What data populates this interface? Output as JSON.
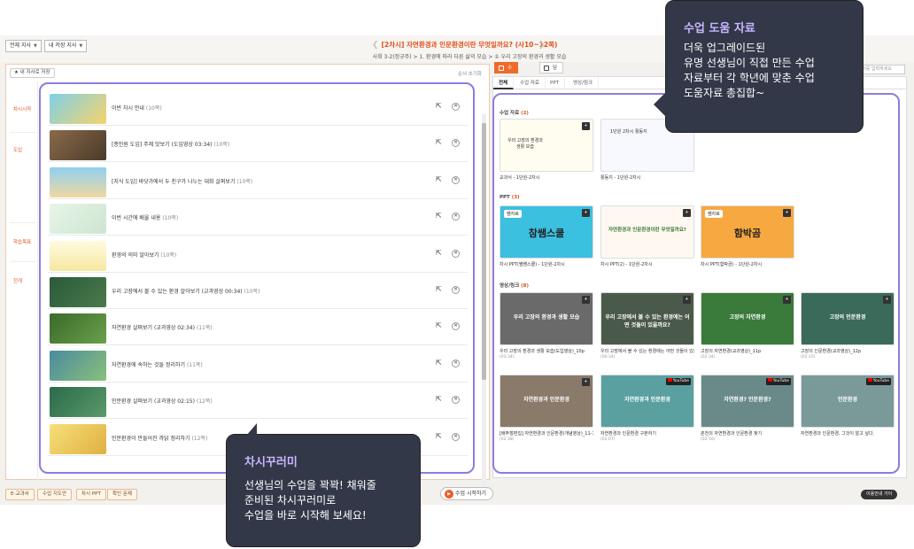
{
  "header": {
    "select_all": "전체 지사",
    "select_mine": "내 저장 지사",
    "title": "[2차시] 자연환경과 인문환경이란 무엇일까요? (사10~12쪽)",
    "subtitle": "사회 3-2(정규주) > 1. 환경에 따라 다른 삶의 모습 > ① 우리 고장의 환경과 생활 모습",
    "prev": "❮",
    "next": "❯"
  },
  "left": {
    "save_button": "★ 내 지사로 저장",
    "reorder": "순서 초기화",
    "phases": [
      "차시시작",
      "도입",
      "학습목표",
      "전개"
    ],
    "rows": [
      {
        "title": "이번 차시 안내",
        "count": "(10쪽)"
      },
      {
        "title": "[종인원 도입] 주제 맛보기 (도입영상 03:34)",
        "count": "(10쪽)"
      },
      {
        "title": "[지식 도입] 바닷가에서 두 친구가 나누는 대화 살펴보기",
        "count": "(10쪽)"
      },
      {
        "title": "이번 시간에 배울 내용",
        "count": "(10쪽)"
      },
      {
        "title": "환경의 의미 알아보기",
        "count": "(10쪽)"
      },
      {
        "title": "우리 고장에서 볼 수 있는 환경 알아보기 (교과영상 00:34)",
        "count": "(10쪽)"
      },
      {
        "title": "자연환경 살펴보기 (교과영상 02:34)",
        "count": "(11쪽)"
      },
      {
        "title": "자연환경에 속하는 것들 정리하기",
        "count": "(11쪽)"
      },
      {
        "title": "인문환경 살펴보기 (교과영상 02:15)",
        "count": "(12쪽)"
      },
      {
        "title": "인문환경이 만들어진 까닭 정리하기",
        "count": "(12쪽)"
      }
    ]
  },
  "bottom": {
    "btn1": "E-교과서",
    "btn2": "수업 지도안",
    "btn3": "차시 PPT",
    "btn4": "확인 문제",
    "start": "수업 시작하기",
    "guide": "이용안내 가이"
  },
  "right": {
    "tab_help": "수업 도움 자료",
    "tab_saved": "담은 자료",
    "search_placeholder": "검색어를 입력하세요",
    "sub_tabs": [
      "전체",
      "수업 자료",
      "PPT",
      "영상/링크"
    ],
    "sec_class": "수업 자료",
    "sec_class_n": "(2)",
    "sec_ppt": "PPT",
    "sec_ppt_n": "(3)",
    "sec_video": "영상/링크",
    "sec_video_n": "(8)",
    "class_cards": [
      {
        "label": "교과서 - 1단원-2차시",
        "thumb_text": "우리 고장의 환경과 생활 모습"
      },
      {
        "label": "활동지 - 1단원-2차시",
        "thumb_text": "1단원 2차시 활동지"
      }
    ],
    "ppt_cards": [
      {
        "label": "차시 PPT(쌤쌤스쿨) - 1단원-2차시",
        "badge": "쌤자료",
        "big": "참쌤스쿨"
      },
      {
        "label": "차시 PPT(2) - 1단원-2차시",
        "badge": "",
        "big": "자연환경과 인문환경이란 무엇일까요?"
      },
      {
        "label": "차시 PPT(함박곰) - 1단원-2차시",
        "badge": "쌤자료",
        "big": "함박곰"
      }
    ],
    "video_cards": [
      {
        "label": "우리 고장의 환경과 생활 모습(도입영상)_10p",
        "dur": "(03:34)",
        "yt": false,
        "caption": "우리 고장의 환경과 생활 모습"
      },
      {
        "label": "우리 고장에서 볼 수 있는 환경에는 어떤 것들이 있을까요?(교과영상)_10p",
        "dur": "(00:34)",
        "yt": false,
        "caption": "우리 고장에서 볼 수 있는 환경에는 어떤 것들이 있을까요?"
      },
      {
        "label": "고장의 자연환경(교과영상)_11p",
        "dur": "(02:34)",
        "yt": false,
        "caption": "고장의 자연환경"
      },
      {
        "label": "고장의 인문환경(교과영상)_12p",
        "dur": "(02:15)",
        "yt": false,
        "caption": "고장의 인문환경"
      },
      {
        "label": "[배주철편집] 자연환경과 인문환경(개념영상)_11-12p",
        "dur": "(02:38)",
        "yt": false,
        "caption": "자연환경과 인문환경"
      },
      {
        "label": "자연환경과 인문환경 구분하기",
        "dur": "(02:07)",
        "yt": true,
        "caption": "자연환경과 인문환경"
      },
      {
        "label": "춘천의 자연환경과 인문환경 찾기",
        "dur": "(02:16)",
        "yt": true,
        "caption": "자연환경? 인문환경?"
      },
      {
        "label": "자연환경과 인문환경, 그것이 알고 싶다.",
        "dur": "",
        "yt": true,
        "caption": "인문환경"
      }
    ],
    "youtube": "YouTube"
  },
  "callout_right": {
    "title": "수업 도움 자료",
    "lines": [
      "더욱 업그레이드된",
      "유명 선생님이 직접 만든 수업",
      "자료부터 각 학년에 맞춘 수업",
      "도움자료 총집합~"
    ]
  },
  "callout_left": {
    "title": "차시꾸러미",
    "lines": [
      "선생님의 수업을 꽉꽉! 채워줄",
      "준비된 차시꾸러미로",
      "수업을 바로 시작해 보세요!"
    ]
  },
  "colors": {
    "accent": "#ef6a2a",
    "highlight": "#8e7ce0",
    "callout_bg": "#333849"
  }
}
